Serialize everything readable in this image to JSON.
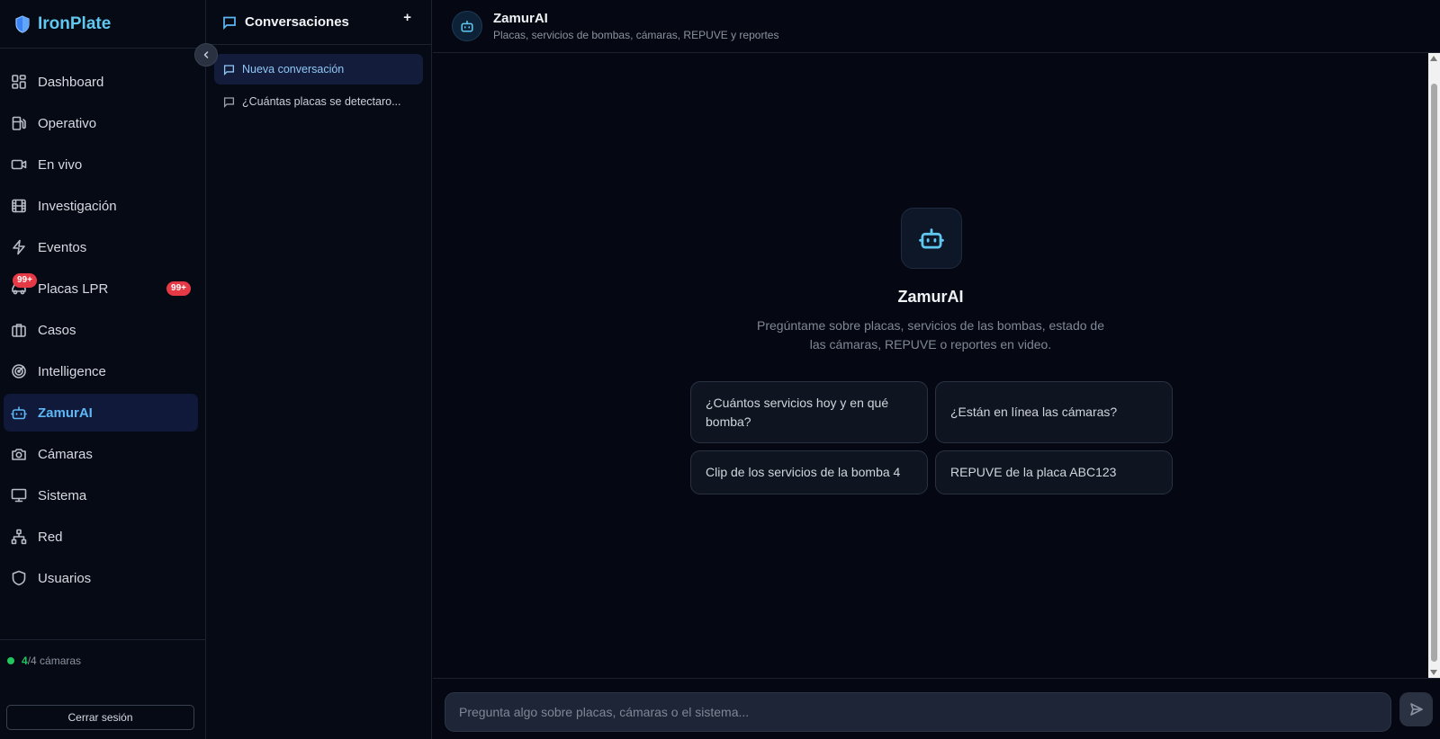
{
  "brand": {
    "name": "IronPlate"
  },
  "sidebar": {
    "items": [
      {
        "label": "Dashboard",
        "icon": "dashboard-icon"
      },
      {
        "label": "Operativo",
        "icon": "fuel-pump-icon"
      },
      {
        "label": "En vivo",
        "icon": "video-icon"
      },
      {
        "label": "Investigación",
        "icon": "film-icon"
      },
      {
        "label": "Eventos",
        "icon": "lightning-icon"
      },
      {
        "label": "Placas LPR",
        "icon": "car-icon",
        "badge": "99+"
      },
      {
        "label": "Casos",
        "icon": "briefcase-icon"
      },
      {
        "label": "Intelligence",
        "icon": "radar-icon"
      },
      {
        "label": "ZamurAI",
        "icon": "bot-icon",
        "active": true
      },
      {
        "label": "Cámaras",
        "icon": "camera-icon"
      },
      {
        "label": "Sistema",
        "icon": "monitor-icon"
      },
      {
        "label": "Red",
        "icon": "network-icon"
      },
      {
        "label": "Usuarios",
        "icon": "shield-icon"
      }
    ],
    "camera_status": {
      "online": "4",
      "total_text": "/4 cámaras"
    },
    "logout_label": "Cerrar sesión"
  },
  "conversations": {
    "title": "Conversaciones",
    "add_label": "+",
    "items": [
      {
        "label": "Nueva conversación",
        "active": true
      },
      {
        "label": "¿Cuántas placas se detectaro..."
      }
    ]
  },
  "chat": {
    "title": "ZamurAI",
    "subtitle": "Placas, servicios de bombas, cámaras, REPUVE y reportes",
    "hero_title": "ZamurAI",
    "hero_desc": "Pregúntame sobre placas, servicios de las bombas, estado de las cámaras, REPUVE o reportes en video.",
    "suggestions": [
      "¿Cuántos servicios hoy y en qué bomba?",
      "¿Están en línea las cámaras?",
      "Clip de los servicios de la bomba 4",
      "REPUVE de la placa ABC123"
    ],
    "input_placeholder": "Pregunta algo sobre placas, cámaras o el sistema..."
  },
  "colors": {
    "accent": "#5eb8f5",
    "brand": "#60c8f0",
    "badge": "#e53945",
    "online": "#22c55e",
    "bg": "#050812"
  }
}
